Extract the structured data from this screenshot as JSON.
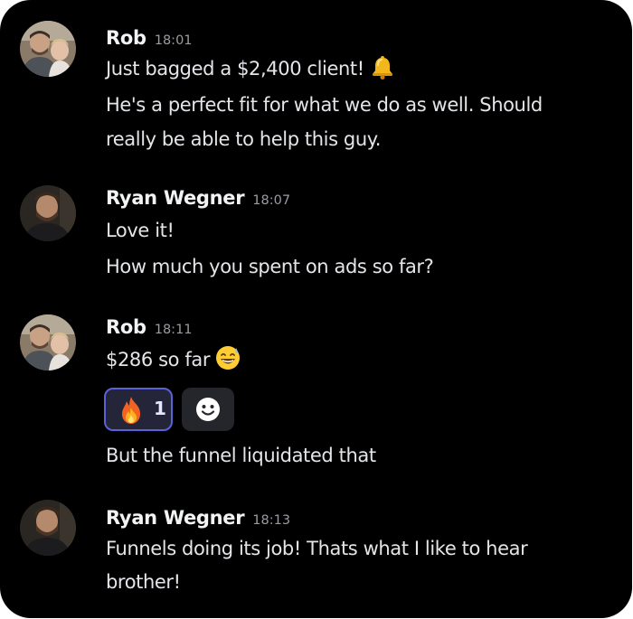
{
  "messages": [
    {
      "author": "Rob",
      "time": "18:01",
      "lines": [
        "Just bagged a $2,400 client!",
        "He's a perfect fit for what we do as well. Should",
        "really be able to help this guy."
      ],
      "emoji": "bell-emoji"
    },
    {
      "author": "Ryan Wegner",
      "time": "18:07",
      "lines": [
        "Love it!",
        "How much you spent on ads so far?"
      ]
    },
    {
      "author": "Rob",
      "time": "18:11",
      "lines": [
        "$286 so far",
        "But the funnel liquidated that"
      ],
      "emoji": "grinning-sweat-emoji",
      "reaction": {
        "emoji": "fire-emoji",
        "count": "1"
      }
    },
    {
      "author": "Ryan Wegner",
      "time": "18:13",
      "lines": [
        "Funnels doing its job! Thats what I like to hear",
        "brother!"
      ]
    }
  ],
  "colors": {
    "background": "#000000",
    "author": "#f2f3f5",
    "timestamp": "#9a9ca3",
    "message_text": "#e3e5e8",
    "reaction_border": "#5a62d6",
    "reaction_bg": "#25253a"
  }
}
